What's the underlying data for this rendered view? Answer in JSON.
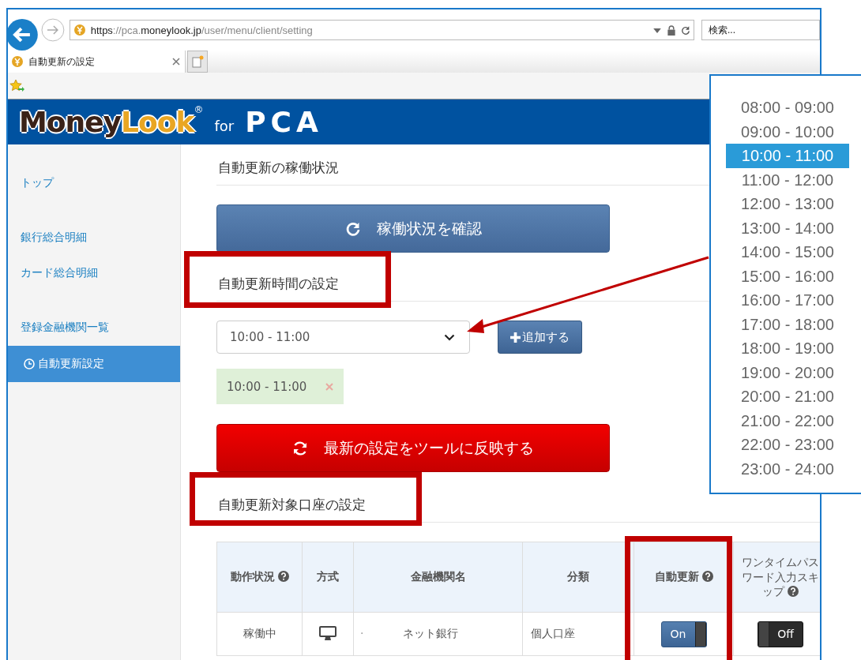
{
  "browser": {
    "url": "**https**://pca.**moneylook.jp**/user/menu/client/setting",
    "search": {
      "placeholder": "検索..."
    },
    "tab": {
      "title": "自動更新の設定"
    }
  },
  "banner": {
    "logo_dark": "Money",
    "logo_gold": "Look",
    "registered": "®",
    "for": "for",
    "brand": "PCA"
  },
  "sidebar": {
    "items": [
      {
        "label": "トップ",
        "selected": false
      },
      {
        "label": "銀行総合明細",
        "selected": false
      },
      {
        "label": "カード総合明細",
        "selected": false
      },
      {
        "label": "登録金融機関一覧",
        "selected": false
      },
      {
        "label": "自動更新設定",
        "selected": true
      }
    ]
  },
  "status_section": {
    "heading": "自動更新の稼働状況",
    "button": "稼働状況を確認"
  },
  "time_section": {
    "heading": "自動更新時間の設定",
    "highlighted": true,
    "select": {
      "value": "10:00 - 11:00"
    },
    "add_button": "追加する",
    "chips": [
      "10:00 - 11:00"
    ],
    "apply_button": "最新の設定をツールに反映する"
  },
  "account_section": {
    "heading": "自動更新対象口座の設定",
    "highlighted": true,
    "columns": [
      {
        "label": "動作状況",
        "help": true
      },
      {
        "label": "方式"
      },
      {
        "label": "金融機関名"
      },
      {
        "label": "分類"
      },
      {
        "label": "自動更新",
        "help": true,
        "highlighted": true
      },
      {
        "label": "ワンタイムパスワード入力スキップ",
        "help": true
      }
    ],
    "rows": [
      {
        "status": "稼働中",
        "method": {
          "kind": "desktop"
        },
        "bank_mark": "·",
        "bank": "ネット銀行",
        "category": "個人口座",
        "auto_update": {
          "on": true,
          "label": "On"
        },
        "otp_skip": {
          "on": false,
          "label": "Off"
        }
      }
    ]
  },
  "dropdown": {
    "options": [
      {
        "label": "08:00 - 09:00",
        "selected": false
      },
      {
        "label": "09:00 - 10:00",
        "selected": false
      },
      {
        "label": "10:00 - 11:00",
        "selected": true
      },
      {
        "label": "11:00 - 12:00",
        "selected": false
      },
      {
        "label": "12:00 - 13:00",
        "selected": false
      },
      {
        "label": "13:00 - 14:00",
        "selected": false
      },
      {
        "label": "14:00 - 15:00",
        "selected": false
      },
      {
        "label": "15:00 - 16:00",
        "selected": false
      },
      {
        "label": "16:00 - 17:00",
        "selected": false
      },
      {
        "label": "17:00 - 18:00",
        "selected": false
      },
      {
        "label": "18:00 - 19:00",
        "selected": false
      },
      {
        "label": "19:00 - 20:00",
        "selected": false
      },
      {
        "label": "20:00 - 21:00",
        "selected": false
      },
      {
        "label": "21:00 - 22:00",
        "selected": false
      },
      {
        "label": "22:00 - 23:00",
        "selected": false
      },
      {
        "label": "23:00 - 24:00",
        "selected": false
      }
    ]
  }
}
